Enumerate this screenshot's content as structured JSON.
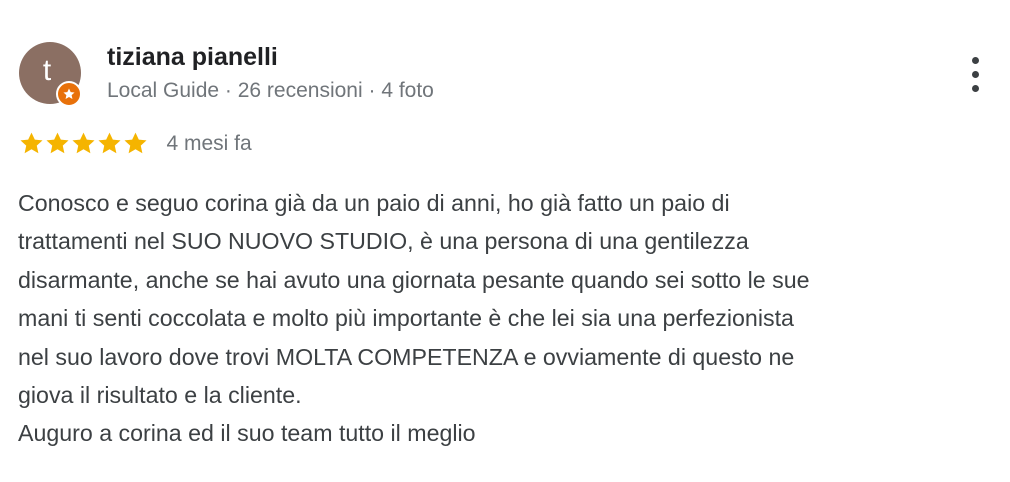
{
  "reviewer": {
    "avatar_letter": "t",
    "name": "tiziana pianelli",
    "meta": "Local Guide · 26 recensioni · 4 foto",
    "avatar_color": "#8b6f63",
    "badge_icon": "local-guide-star-icon",
    "badge_color": "#e8710a"
  },
  "menu": {
    "icon": "more-vert-icon"
  },
  "review": {
    "rating": 5,
    "rating_max": 5,
    "star_color": "#f5b400",
    "date": "4 mesi fa",
    "text_lines": [
      "Conosco e seguo corina già da un paio di anni, ho già fatto un paio di",
      "trattamenti nel SUO NUOVO STUDIO, è una persona di una gentilezza",
      "disarmante, anche se hai avuto una giornata pesante quando sei sotto le sue",
      "mani ti senti coccolata e molto più importante è che lei sia una perfezionista",
      "nel suo lavoro dove trovi MOLTA COMPETENZA e ovviamente di questo ne",
      "giova il risultato e la cliente.",
      "Auguro a corina ed il suo team tutto il meglio"
    ]
  }
}
